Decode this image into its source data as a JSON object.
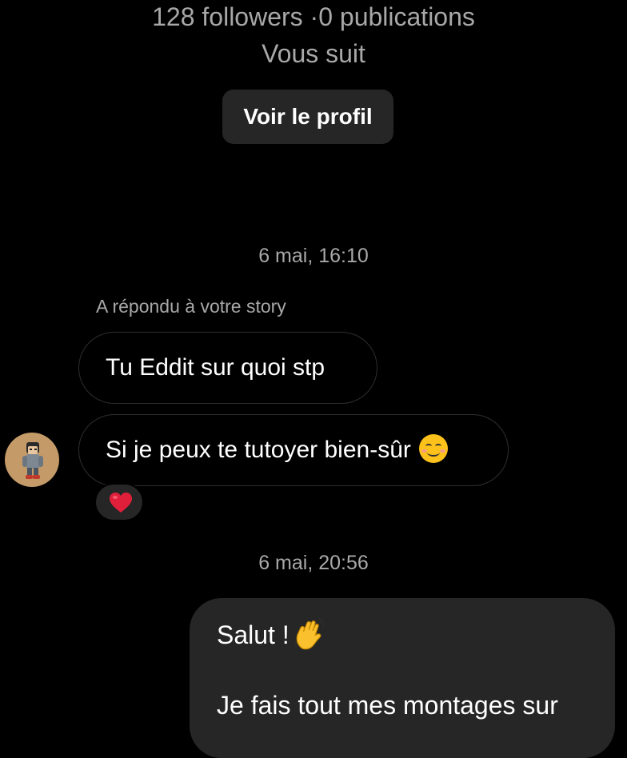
{
  "profile": {
    "stats": "128 followers ·0 publications",
    "follow_status": "Vous suit",
    "view_profile_label": "Voir le profil"
  },
  "conversation": {
    "timestamp_1": "6 mai, 16:10",
    "story_reply_label": "A répondu à votre story",
    "incoming_messages": [
      {
        "text": "Tu Eddit sur quoi stp"
      },
      {
        "text": "Si je peux te tutoyer bien-sûr",
        "emoji": "smiling-face-icon"
      }
    ],
    "reaction": {
      "emoji": "red-heart-icon"
    },
    "timestamp_2": "6 mai, 20:56",
    "outgoing_message": {
      "line_1": "Salut !",
      "line_1_emoji": "waving-hand-icon",
      "line_2": "Je fais tout mes montages sur"
    }
  },
  "colors": {
    "background": "#000000",
    "secondary_text": "#a8a8a8",
    "bubble_dark": "#262626",
    "incoming_border": "#2e2e2e",
    "heart": "#e0203a",
    "wave": "#fbc02d"
  }
}
